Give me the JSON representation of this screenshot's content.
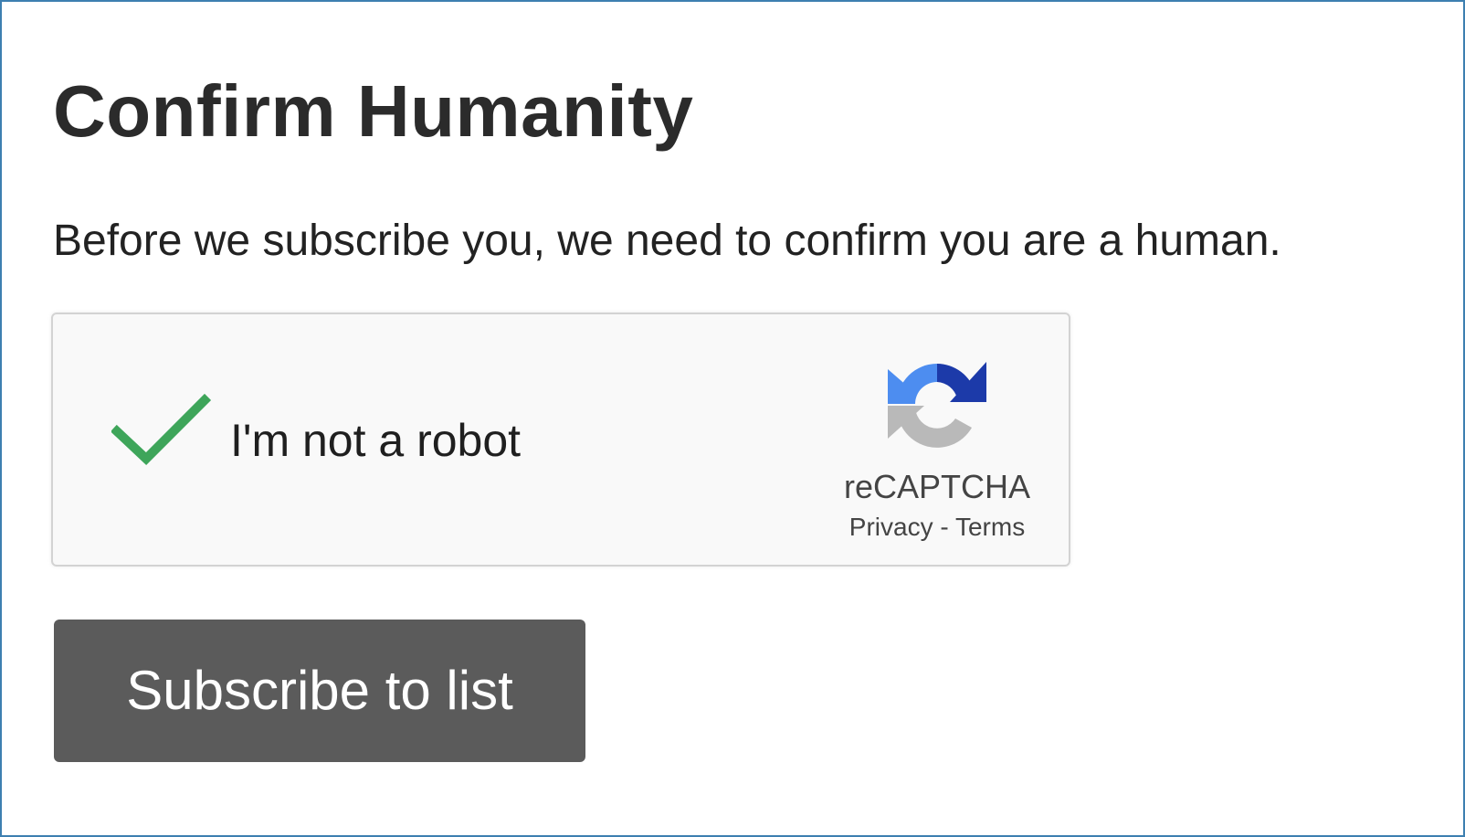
{
  "page": {
    "title": "Confirm Humanity",
    "intro": "Before we subscribe you, we need to confirm you are a human."
  },
  "recaptcha": {
    "checked": true,
    "checkbox_label": "I'm not a robot",
    "brand_name": "reCAPTCHA",
    "privacy_link": "Privacy",
    "separator": " - ",
    "terms_link": "Terms",
    "check_color": "#3ea55a",
    "logo_icon": "recaptcha-logo-icon"
  },
  "actions": {
    "subscribe_label": "Subscribe to list"
  },
  "colors": {
    "frame_border": "#3d7fb0",
    "button_bg": "#5b5b5b",
    "box_bg": "#f9f9f9"
  }
}
